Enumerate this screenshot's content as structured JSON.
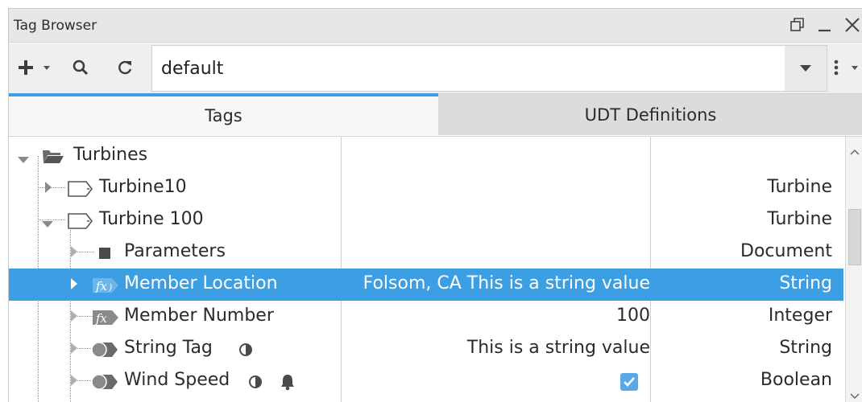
{
  "window": {
    "title": "Tag Browser",
    "controls": [
      "restore-icon",
      "minimize-icon",
      "close-icon"
    ]
  },
  "toolbar": {
    "add_icon": "plus-icon",
    "add_menu_icon": "caret-down-icon",
    "search_icon": "search-icon",
    "refresh_icon": "refresh-icon",
    "provider_value": "default",
    "more_icon": "vertical-ellipsis-icon"
  },
  "tabs": [
    {
      "label": "Tags",
      "active": true
    },
    {
      "label": "UDT Definitions",
      "active": false
    }
  ],
  "colors": {
    "accent": "#3aa0e6",
    "selected_row": "#3c9ee3",
    "icon_gray": "#555555"
  },
  "tree": [
    {
      "name": "Turbines",
      "value": "",
      "type": "",
      "icon": "folder-open-icon",
      "expanded": true,
      "level": 0
    },
    {
      "name": "Turbine10",
      "value": "",
      "type": "Turbine",
      "icon": "udt-instance-icon",
      "expanded": false,
      "level": 1
    },
    {
      "name": "Turbine 100",
      "value": "",
      "type": "Turbine",
      "icon": "udt-instance-icon",
      "expanded": true,
      "level": 1
    },
    {
      "name": "Parameters",
      "value": "",
      "type": "Document",
      "icon": "parameters-square-icon",
      "expanded": false,
      "level": 2
    },
    {
      "name": "Member Location",
      "value": "Folsom, CA This is a string value",
      "type": "String",
      "icon": "expression-tag-icon",
      "expanded": false,
      "level": 2,
      "selected": true
    },
    {
      "name": "Member Number",
      "value": "100",
      "type": "Integer",
      "icon": "expression-tag-icon",
      "expanded": false,
      "level": 2
    },
    {
      "name": "String Tag",
      "value": "This is a string value",
      "type": "String",
      "icon": "memory-tag-icon",
      "expanded": false,
      "level": 2,
      "badges": [
        "history-icon"
      ]
    },
    {
      "name": "Wind Speed",
      "value": true,
      "type": "Boolean",
      "icon": "memory-tag-icon",
      "expanded": false,
      "level": 2,
      "badges": [
        "history-icon",
        "alarm-bell-icon"
      ]
    }
  ]
}
